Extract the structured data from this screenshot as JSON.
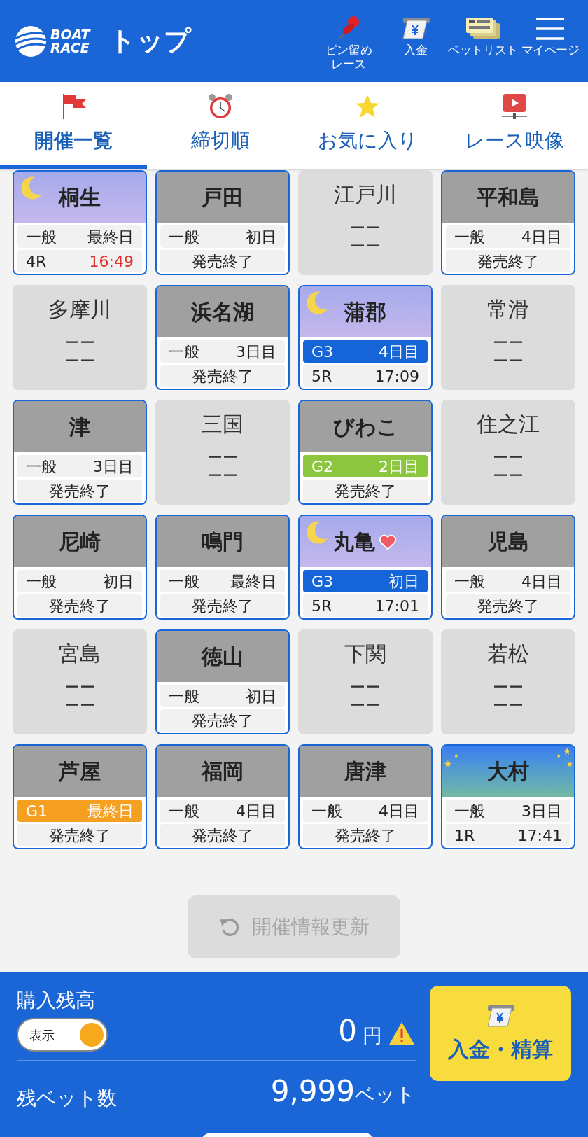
{
  "header": {
    "logo": {
      "line1": "BOAT",
      "line2": "RACE"
    },
    "title": "トップ",
    "actions": [
      {
        "kind": "pin",
        "label": "ピン留めレース"
      },
      {
        "kind": "deposit",
        "label": "入金"
      },
      {
        "kind": "tickets",
        "label": "ベットリスト"
      },
      {
        "kind": "menu",
        "label": "マイページ"
      }
    ]
  },
  "tabs": [
    {
      "kind": "flag",
      "label": "開催一覧",
      "selected": true
    },
    {
      "kind": "clock",
      "label": "締切順",
      "selected": false
    },
    {
      "kind": "star",
      "label": "お気に入り",
      "selected": false
    },
    {
      "kind": "video",
      "label": "レース映像",
      "selected": false
    }
  ],
  "venues": [
    {
      "name": "桐生",
      "kind": "night",
      "favorite": false,
      "line1": [
        "一般",
        "最終日"
      ],
      "line2": [
        "4R",
        "16:49"
      ],
      "urgent": true
    },
    {
      "name": "戸田",
      "kind": "day",
      "favorite": false,
      "line1": [
        "一般",
        "初日"
      ],
      "line2": [
        "発売終了"
      ]
    },
    {
      "name": "江戸川",
      "kind": "closed",
      "lines": [
        "ーー",
        "ーー"
      ]
    },
    {
      "name": "平和島",
      "kind": "day",
      "favorite": false,
      "line1": [
        "一般",
        "4日目"
      ],
      "line2": [
        "発売終了"
      ]
    },
    {
      "name": "多摩川",
      "kind": "closed",
      "lines": [
        "ーー",
        "ーー"
      ]
    },
    {
      "name": "浜名湖",
      "kind": "day",
      "favorite": false,
      "line1": [
        "一般",
        "3日目"
      ],
      "line2": [
        "発売終了"
      ]
    },
    {
      "name": "蒲郡",
      "kind": "night",
      "favorite": false,
      "line1": [
        "G3",
        "4日目"
      ],
      "color": "#1565d8",
      "line2": [
        "5R",
        "17:09"
      ],
      "urgent": false
    },
    {
      "name": "常滑",
      "kind": "closed",
      "lines": [
        "ーー",
        "ーー"
      ]
    },
    {
      "name": "津",
      "kind": "day",
      "favorite": false,
      "line1": [
        "一般",
        "3日目"
      ],
      "line2": [
        "発売終了"
      ]
    },
    {
      "name": "三国",
      "kind": "closed",
      "lines": [
        "ーー",
        "ーー"
      ]
    },
    {
      "name": "びわこ",
      "kind": "day",
      "favorite": false,
      "line1": [
        "G2",
        "2日目"
      ],
      "color": "#8cc63f",
      "line2": [
        "発売終了"
      ]
    },
    {
      "name": "住之江",
      "kind": "closed",
      "lines": [
        "ーー",
        "ーー"
      ]
    },
    {
      "name": "尼崎",
      "kind": "day",
      "favorite": false,
      "line1": [
        "一般",
        "初日"
      ],
      "line2": [
        "発売終了"
      ]
    },
    {
      "name": "鳴門",
      "kind": "day",
      "favorite": false,
      "line1": [
        "一般",
        "最終日"
      ],
      "line2": [
        "発売終了"
      ]
    },
    {
      "name": "丸亀",
      "kind": "night",
      "favorite": true,
      "line1": [
        "G3",
        "初日"
      ],
      "color": "#1565d8",
      "line2": [
        "5R",
        "17:01"
      ],
      "urgent": false
    },
    {
      "name": "児島",
      "kind": "day",
      "favorite": false,
      "line1": [
        "一般",
        "4日目"
      ],
      "line2": [
        "発売終了"
      ]
    },
    {
      "name": "宮島",
      "kind": "closed",
      "lines": [
        "ーー",
        "ーー"
      ]
    },
    {
      "name": "徳山",
      "kind": "day",
      "favorite": false,
      "line1": [
        "一般",
        "初日"
      ],
      "line2": [
        "発売終了"
      ]
    },
    {
      "name": "下関",
      "kind": "closed",
      "lines": [
        "ーー",
        "ーー"
      ]
    },
    {
      "name": "若松",
      "kind": "closed",
      "lines": [
        "ーー",
        "ーー"
      ]
    },
    {
      "name": "芦屋",
      "kind": "day",
      "favorite": false,
      "line1": [
        "G1",
        "最終日"
      ],
      "color": "#f5a020",
      "line2": [
        "発売終了"
      ]
    },
    {
      "name": "福岡",
      "kind": "day",
      "favorite": false,
      "line1": [
        "一般",
        "4日目"
      ],
      "line2": [
        "発売終了"
      ]
    },
    {
      "name": "唐津",
      "kind": "day",
      "favorite": false,
      "line1": [
        "一般",
        "4日目"
      ],
      "line2": [
        "発売終了"
      ]
    },
    {
      "name": "大村",
      "kind": "starry",
      "favorite": false,
      "line1": [
        "一般",
        "3日目"
      ],
      "line2": [
        "1R",
        "17:41"
      ],
      "urgent": false
    }
  ],
  "refresh_button": {
    "label": "開催情報更新",
    "disabled": true
  },
  "footer": {
    "balance_label": "購入残高",
    "toggle": {
      "label": "表示",
      "on": true
    },
    "balance": "0",
    "currency": "円",
    "warning": true,
    "bets_label": "残ベット数",
    "bets": "9,999",
    "bets_unit": "ベット",
    "deposit_button": "入金・精算"
  }
}
